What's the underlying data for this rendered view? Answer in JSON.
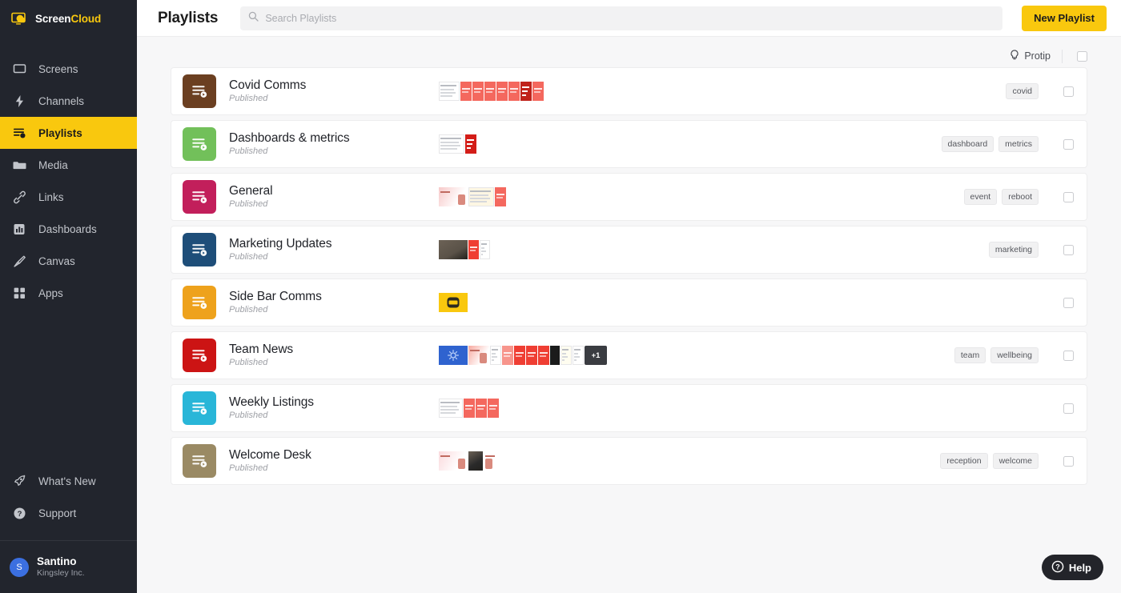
{
  "brand": {
    "name_part1": "Screen",
    "name_part2": "Cloud",
    "logo_icon": "screen-cloud-logo"
  },
  "sidebar": {
    "items": [
      {
        "label": "Screens",
        "icon": "monitor-icon",
        "active": false
      },
      {
        "label": "Channels",
        "icon": "bolt-icon",
        "active": false
      },
      {
        "label": "Playlists",
        "icon": "playlist-icon",
        "active": true
      },
      {
        "label": "Media",
        "icon": "folder-icon",
        "active": false
      },
      {
        "label": "Links",
        "icon": "link-icon",
        "active": false
      },
      {
        "label": "Dashboards",
        "icon": "chart-icon",
        "active": false
      },
      {
        "label": "Canvas",
        "icon": "brush-icon",
        "active": false
      },
      {
        "label": "Apps",
        "icon": "grid-apps-icon",
        "active": false
      }
    ],
    "bottom_items": [
      {
        "label": "What's New",
        "icon": "rocket-icon"
      },
      {
        "label": "Support",
        "icon": "question-circle-icon"
      }
    ],
    "user": {
      "initial": "S",
      "name": "Santino",
      "org": "Kingsley Inc."
    },
    "active_color": "#f9c80e",
    "background": "#22252d"
  },
  "header": {
    "title": "Playlists",
    "search": {
      "placeholder": "Search Playlists",
      "value": "",
      "icon": "search-icon"
    },
    "new_button": {
      "label": "New Playlist",
      "color": "#f9c80e"
    }
  },
  "utilbar": {
    "protip_label": "Protip",
    "protip_icon": "lightbulb-icon",
    "select_all_checked": false
  },
  "playlists": [
    {
      "name": "Covid Comms",
      "status": "Published",
      "icon": "playlist-icon",
      "icon_color": "#6b3f21",
      "tags": [
        "covid"
      ],
      "thumbs": [
        {
          "w": 26,
          "kind": "doc",
          "color": "#ffffff"
        },
        {
          "w": 14,
          "kind": "card",
          "color": "#f4685e"
        },
        {
          "w": 14,
          "kind": "card",
          "color": "#f4685e"
        },
        {
          "w": 14,
          "kind": "card",
          "color": "#f4685e"
        },
        {
          "w": 14,
          "kind": "card",
          "color": "#f4685e"
        },
        {
          "w": 14,
          "kind": "card",
          "color": "#f4685e"
        },
        {
          "w": 14,
          "kind": "dark",
          "color": "#c0241c"
        },
        {
          "w": 14,
          "kind": "card",
          "color": "#f4685e"
        }
      ],
      "extra_count": null
    },
    {
      "name": "Dashboards & metrics",
      "status": "Published",
      "icon": "playlist-icon",
      "icon_color": "#72c05a",
      "tags": [
        "dashboard",
        "metrics"
      ],
      "thumbs": [
        {
          "w": 32,
          "kind": "doc",
          "color": "#ffffff"
        },
        {
          "w": 14,
          "kind": "dark",
          "color": "#d31d18"
        }
      ],
      "extra_count": null
    },
    {
      "name": "General",
      "status": "Published",
      "icon": "playlist-icon",
      "icon_color": "#c21f5b",
      "tags": [
        "event",
        "reboot"
      ],
      "thumbs": [
        {
          "w": 36,
          "kind": "photo",
          "color": "#f7c9c9"
        },
        {
          "w": 32,
          "kind": "doc",
          "color": "#fdf6e3"
        },
        {
          "w": 14,
          "kind": "card",
          "color": "#f4685e"
        }
      ],
      "extra_count": null
    },
    {
      "name": "Marketing Updates",
      "status": "Published",
      "icon": "playlist-icon",
      "icon_color": "#1e4e79",
      "tags": [
        "marketing"
      ],
      "thumbs": [
        {
          "w": 36,
          "kind": "photodark",
          "color": "#5a5248"
        },
        {
          "w": 13,
          "kind": "card",
          "color": "#ef3e33"
        },
        {
          "w": 13,
          "kind": "doc",
          "color": "#ffffff"
        }
      ],
      "extra_count": null
    },
    {
      "name": "Side Bar Comms",
      "status": "Published",
      "icon": "playlist-icon",
      "icon_color": "#eea21c",
      "tags": [],
      "thumbs": [
        {
          "w": 36,
          "kind": "yellow",
          "color": "#f9c80e"
        }
      ],
      "extra_count": null
    },
    {
      "name": "Team News",
      "status": "Published",
      "icon": "playlist-icon",
      "icon_color": "#cc1414",
      "tags": [
        "team",
        "wellbeing"
      ],
      "thumbs": [
        {
          "w": 36,
          "kind": "blue",
          "color": "#2f63cf"
        },
        {
          "w": 26,
          "kind": "photo",
          "color": "#f7a9a0"
        },
        {
          "w": 14,
          "kind": "doc",
          "color": "#ffffff"
        },
        {
          "w": 14,
          "kind": "card",
          "color": "#f7958c"
        },
        {
          "w": 14,
          "kind": "card",
          "color": "#ef3e33"
        },
        {
          "w": 14,
          "kind": "card",
          "color": "#ef3e33"
        },
        {
          "w": 14,
          "kind": "card",
          "color": "#ef3e33"
        },
        {
          "w": 12,
          "kind": "black",
          "color": "#1b1b1b"
        },
        {
          "w": 14,
          "kind": "doc",
          "color": "#fffdf0"
        },
        {
          "w": 14,
          "kind": "doc",
          "color": "#ffffff"
        }
      ],
      "extra_count": "+1"
    },
    {
      "name": "Weekly Listings",
      "status": "Published",
      "icon": "playlist-icon",
      "icon_color": "#29b6d8",
      "tags": [],
      "thumbs": [
        {
          "w": 30,
          "kind": "doc",
          "color": "#ffffff"
        },
        {
          "w": 14,
          "kind": "card",
          "color": "#f4685e"
        },
        {
          "w": 14,
          "kind": "card",
          "color": "#f4685e"
        },
        {
          "w": 14,
          "kind": "card",
          "color": "#f4685e"
        }
      ],
      "extra_count": null
    },
    {
      "name": "Welcome Desk",
      "status": "Published",
      "icon": "playlist-icon",
      "icon_color": "#9a8a64",
      "tags": [
        "reception",
        "welcome"
      ],
      "thumbs": [
        {
          "w": 36,
          "kind": "photo",
          "color": "#fadadd"
        },
        {
          "w": 18,
          "kind": "photodark",
          "color": "#2a2a2a"
        },
        {
          "w": 14,
          "kind": "photo",
          "color": "#ffffff"
        }
      ],
      "extra_count": null
    }
  ],
  "help": {
    "label": "Help",
    "icon": "question-circle-icon"
  }
}
